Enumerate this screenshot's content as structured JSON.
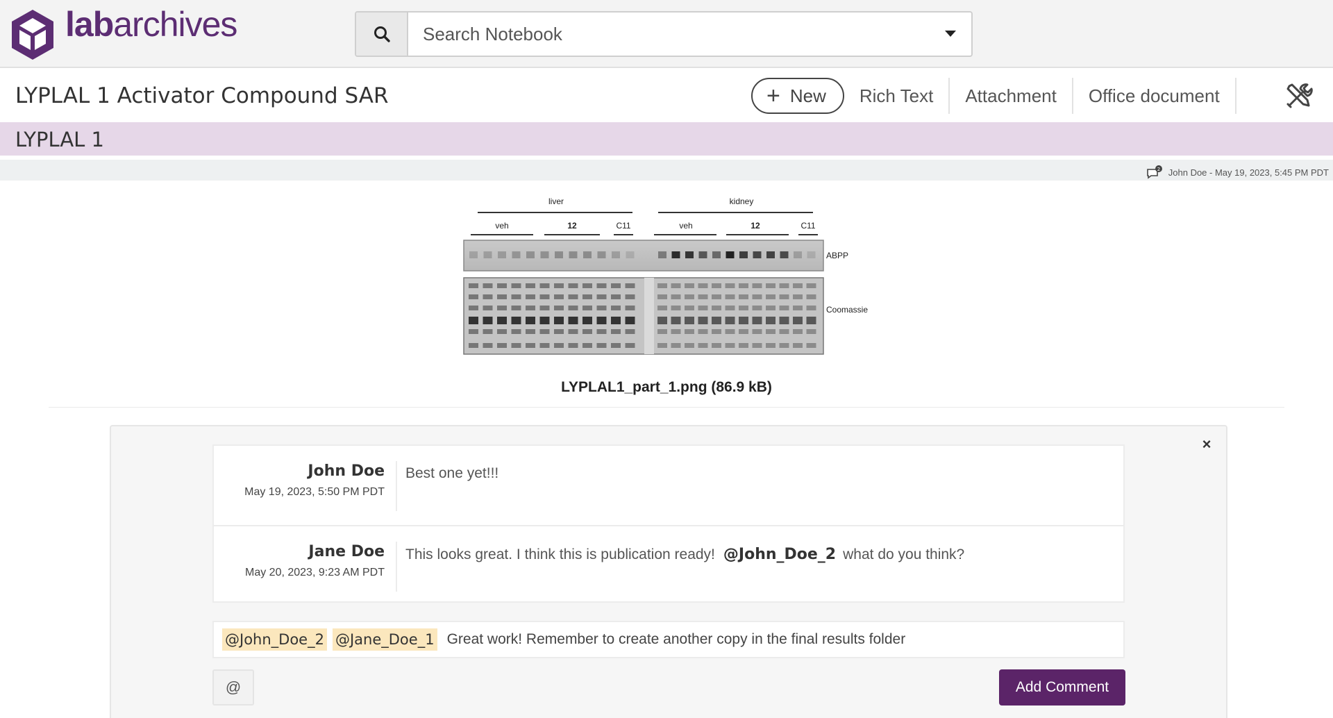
{
  "header": {
    "brand_prefix": "lab",
    "brand_suffix": "archives",
    "search_placeholder": "Search Notebook"
  },
  "page": {
    "title": "LYPLAL 1 Activator Compound SAR"
  },
  "toolbar": {
    "new_label": "New",
    "rich_text_label": "Rich Text",
    "attachment_label": "Attachment",
    "office_document_label": "Office document"
  },
  "section": {
    "title": "LYPLAL 1",
    "meta": "John Doe - May 19, 2023, 5:45 PM PDT",
    "comment_count": "2"
  },
  "figure": {
    "group_labels": [
      "liver",
      "kidney"
    ],
    "lane_labels": [
      "veh",
      "12",
      "C11",
      "veh",
      "12",
      "C11"
    ],
    "row_labels": [
      "ABPP",
      "Coomassie"
    ]
  },
  "attachment": {
    "filename": "LYPLAL1_part_1.png (86.9 kB)"
  },
  "comments": [
    {
      "author": "John Doe",
      "date": "May 19, 2023, 5:50 PM PDT",
      "text": "Best one yet!!!"
    },
    {
      "author": "Jane Doe",
      "date": "May 20, 2023, 9:23 AM PDT",
      "text_before": "This looks great. I think this is publication ready!",
      "mention": "@John_Doe_2",
      "text_after": "what do you think?"
    }
  ],
  "composer": {
    "tags": [
      "@John_Doe_2",
      "@Jane_Doe_1"
    ],
    "text": "Great work! Remember to create another copy in the final results folder",
    "at_label": "@",
    "submit_label": "Add Comment",
    "close_label": "×"
  },
  "colors": {
    "brand": "#5c2d73",
    "section_bg": "#e6d7e8",
    "button_primary": "#5b2468",
    "tag_bg": "#fbe7bd"
  }
}
